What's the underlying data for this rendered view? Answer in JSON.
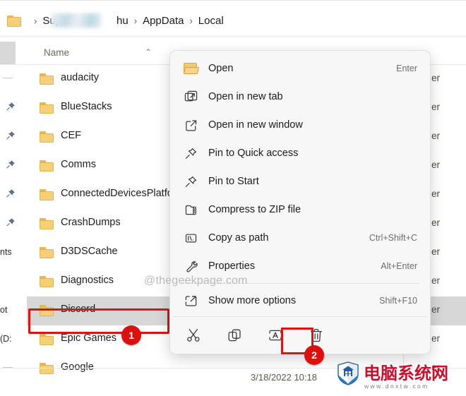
{
  "breadcrumb": {
    "folder_icon": "folder-icon",
    "segments": [
      "Sup",
      "hu",
      "AppData",
      "Local"
    ],
    "separator": "›",
    "blurred_note": "blurred-username"
  },
  "columns": {
    "name_header": "Name",
    "sort_indicator": "⌃"
  },
  "nav_pane": {
    "fragments": [
      {
        "label": "",
        "pin": false,
        "dash": true
      },
      {
        "label": "",
        "pin": true
      },
      {
        "label": "",
        "pin": true
      },
      {
        "label": "",
        "pin": true
      },
      {
        "label": "",
        "pin": true
      },
      {
        "label": "",
        "pin": true
      },
      {
        "label": "nts",
        "pin": false
      },
      {
        "label": "",
        "pin": false
      },
      {
        "label": "ot",
        "pin": false
      },
      {
        "label": "(D:",
        "pin": false
      },
      {
        "label": "",
        "pin": false,
        "dash": true
      }
    ]
  },
  "file_list": {
    "type_text": "er",
    "rows": [
      {
        "name": "audacity",
        "selected": false
      },
      {
        "name": "BlueStacks",
        "selected": false
      },
      {
        "name": "CEF",
        "selected": false
      },
      {
        "name": "Comms",
        "selected": false
      },
      {
        "name": "ConnectedDevicesPlatfor",
        "selected": false
      },
      {
        "name": "CrashDumps",
        "selected": false
      },
      {
        "name": "D3DSCache",
        "selected": false
      },
      {
        "name": "Diagnostics",
        "selected": false
      },
      {
        "name": "Discord",
        "selected": true
      },
      {
        "name": "Epic Games",
        "selected": false
      },
      {
        "name": "Google",
        "selected": false
      }
    ]
  },
  "context_menu": {
    "items": [
      {
        "label": "Open",
        "shortcut": "Enter",
        "icon": "open-folder-icon"
      },
      {
        "label": "Open in new tab",
        "shortcut": "",
        "icon": "new-tab-icon"
      },
      {
        "label": "Open in new window",
        "shortcut": "",
        "icon": "new-window-icon"
      },
      {
        "label": "Pin to Quick access",
        "shortcut": "",
        "icon": "pin-icon"
      },
      {
        "label": "Pin to Start",
        "shortcut": "",
        "icon": "pin-icon"
      },
      {
        "label": "Compress to ZIP file",
        "shortcut": "",
        "icon": "zip-icon"
      },
      {
        "label": "Copy as path",
        "shortcut": "Ctrl+Shift+C",
        "icon": "copy-path-icon"
      },
      {
        "label": "Properties",
        "shortcut": "Alt+Enter",
        "icon": "wrench-icon"
      },
      {
        "label": "Show more options",
        "shortcut": "Shift+F10",
        "icon": "more-options-icon"
      }
    ],
    "toolbar": [
      {
        "name": "cut-icon",
        "title": "Cut"
      },
      {
        "name": "copy-icon",
        "title": "Copy"
      },
      {
        "name": "rename-icon",
        "title": "Rename"
      },
      {
        "name": "delete-icon",
        "title": "Delete"
      }
    ]
  },
  "annotations": {
    "badge_1": "1",
    "badge_2": "2",
    "color": "#dd1010"
  },
  "status": {
    "date_modified": "3/18/2022 10:18"
  },
  "watermarks": {
    "geekpage": "@thegeekpage.com",
    "cn_logo_text": "电脑系统网",
    "cn_url": "www.dnxtw.com"
  }
}
